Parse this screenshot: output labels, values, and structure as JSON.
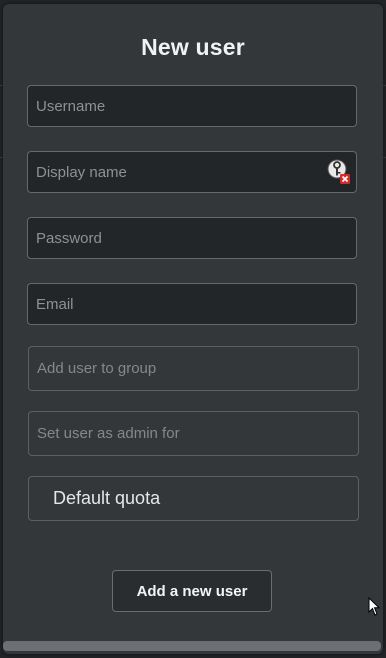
{
  "dialog": {
    "title": "New user",
    "fields": {
      "username_placeholder": "Username",
      "display_name_placeholder": "Display name",
      "password_placeholder": "Password",
      "email_placeholder": "Email",
      "group_placeholder": "Add user to group",
      "admin_placeholder": "Set user as admin for",
      "quota_label": "Default quota"
    },
    "submit_label": "Add a new user",
    "icons": {
      "password_manager": "password-manager-key-icon"
    }
  }
}
